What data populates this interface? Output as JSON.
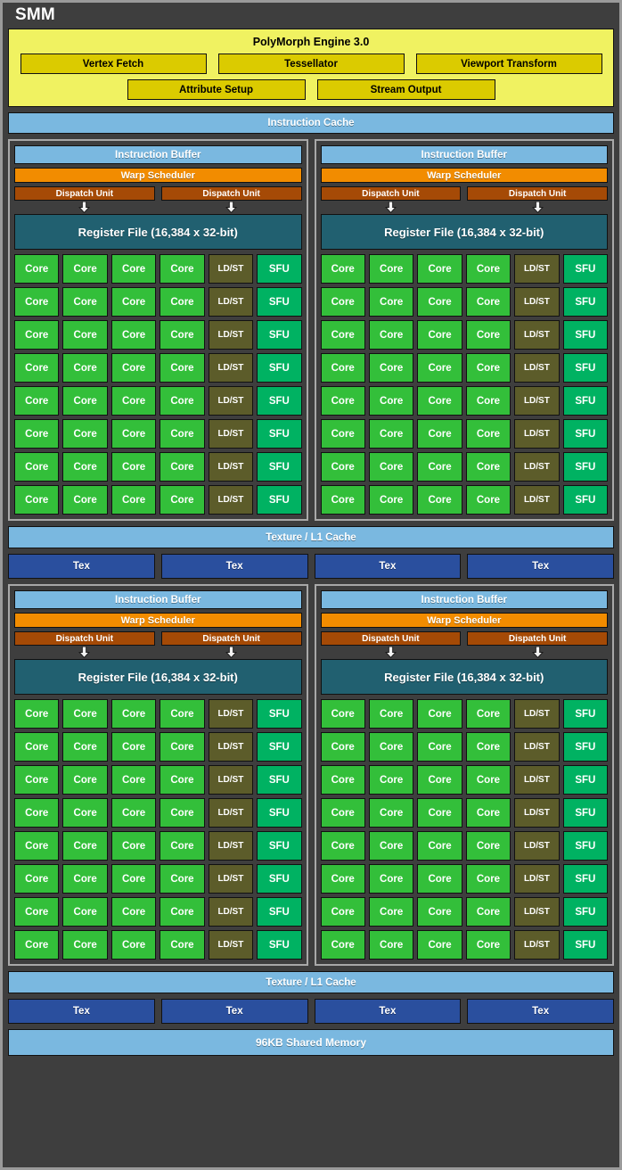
{
  "title": "SMM",
  "polymorph": {
    "title": "PolyMorph Engine 3.0",
    "row1": [
      "Vertex Fetch",
      "Tessellator",
      "Viewport Transform"
    ],
    "row2": [
      "Attribute Setup",
      "Stream Output"
    ]
  },
  "instruction_cache": "Instruction Cache",
  "block": {
    "instruction_buffer": "Instruction Buffer",
    "warp_scheduler": "Warp Scheduler",
    "dispatch_units": [
      "Dispatch Unit",
      "Dispatch Unit"
    ],
    "register_file": "Register File (16,384 x 32-bit)",
    "core_label": "Core",
    "ldst_label": "LD/ST",
    "sfu_label": "SFU",
    "core_rows": 8,
    "cores_per_row": 4
  },
  "texture": {
    "cache_label": "Texture / L1 Cache",
    "tex_label": "Tex",
    "tex_count": 4
  },
  "shared_memory": "96KB Shared Memory",
  "colors": {
    "background": "#3e3e3e",
    "outer_border": "#9a9a9a",
    "polymorph_panel": "#f0f261",
    "polymorph_box": "#dbcb00",
    "light_blue": "#7ab8e0",
    "warp_orange": "#f28c00",
    "dispatch_brown": "#a54a06",
    "register_teal": "#216070",
    "core_green": "#33bf3a",
    "ldst_olive": "#5c5c2a",
    "sfu_emerald": "#00b262",
    "tex_blue": "#2a4f9e",
    "quad_border": "#a8a8a8"
  }
}
